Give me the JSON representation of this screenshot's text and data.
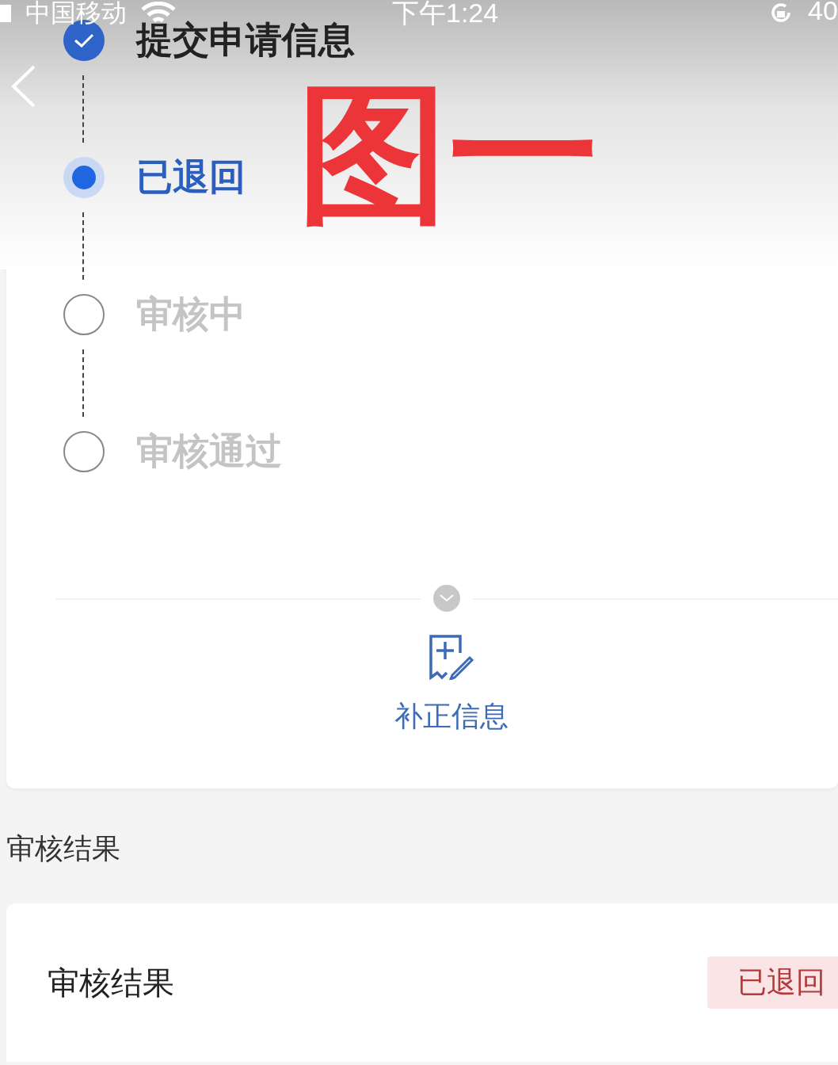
{
  "status_bar": {
    "carrier": "中国移动",
    "time": "下午1:24",
    "battery": "40"
  },
  "annotation": {
    "text": "图一"
  },
  "steps": [
    {
      "label": "提交申请信息",
      "done": true,
      "selected": false
    },
    {
      "label": "已退回",
      "done": false,
      "selected": true
    },
    {
      "label": "审核中",
      "done": false,
      "selected": false
    },
    {
      "label": "审核通过",
      "done": false,
      "selected": false
    }
  ],
  "action": {
    "label": "补正信息"
  },
  "section_title": "审核结果",
  "result": {
    "label": "审核结果",
    "badge": "已退回"
  }
}
